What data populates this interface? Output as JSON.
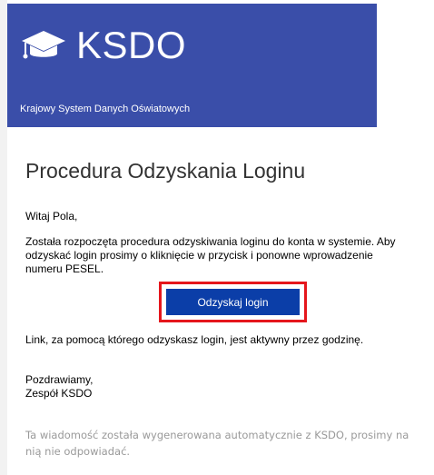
{
  "banner": {
    "brand": "KSDO",
    "subtitle": "Krajowy System Danych Oświatowych",
    "logo_icon": "graduation-cap-icon",
    "background_color": "#3a4ea9"
  },
  "email": {
    "heading": "Procedura Odzyskania Loginu",
    "greeting": "Witaj Pola,",
    "body": "Została rozpoczęta procedura odzyskiwania loginu do konta w systemie. Aby odzyskać login prosimy o kliknięcie w przycisk i ponowne wprowadzenie numeru PESEL.",
    "button_label": "Odzyskaj login",
    "button_color": "#0b3ea8",
    "highlight_color": "#e5161c",
    "link_note": "Link, za pomocą którego odzyskasz login, jest aktywny przez godzinę.",
    "signoff_1": "Pozdrawiamy,",
    "signoff_2": "Zespół KSDO",
    "footer": "Ta wiadomość została wygenerowana automatycznie z KSDO, prosimy na nią nie odpowiadać."
  }
}
